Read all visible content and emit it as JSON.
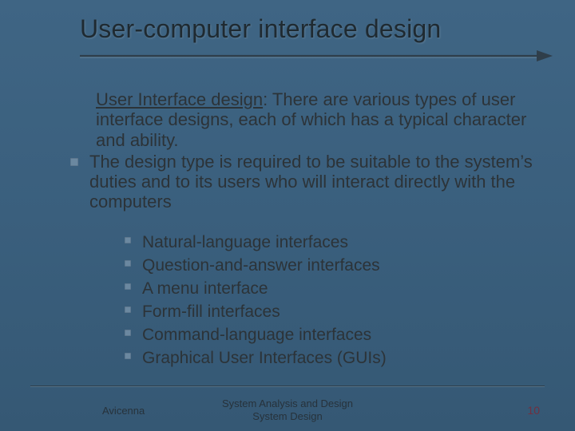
{
  "title": "User-computer interface design",
  "intro": {
    "lead": "User Interface design",
    "rest": ": There are various types of user interface designs, each of which has a typical character and ability."
  },
  "bullet": "The design type is required to be suitable to the system’s duties and to its users who will interact directly with the computers",
  "sublist": [
    "Natural-language interfaces",
    "Question-and-answer interfaces",
    "A menu interface",
    "Form-fill interfaces",
    "Command-language interfaces",
    "Graphical User Interfaces (GUIs)"
  ],
  "footer": {
    "left": "Avicenna",
    "center_line1": "System Analysis and Design",
    "center_line2": "System Design",
    "page": "10"
  }
}
